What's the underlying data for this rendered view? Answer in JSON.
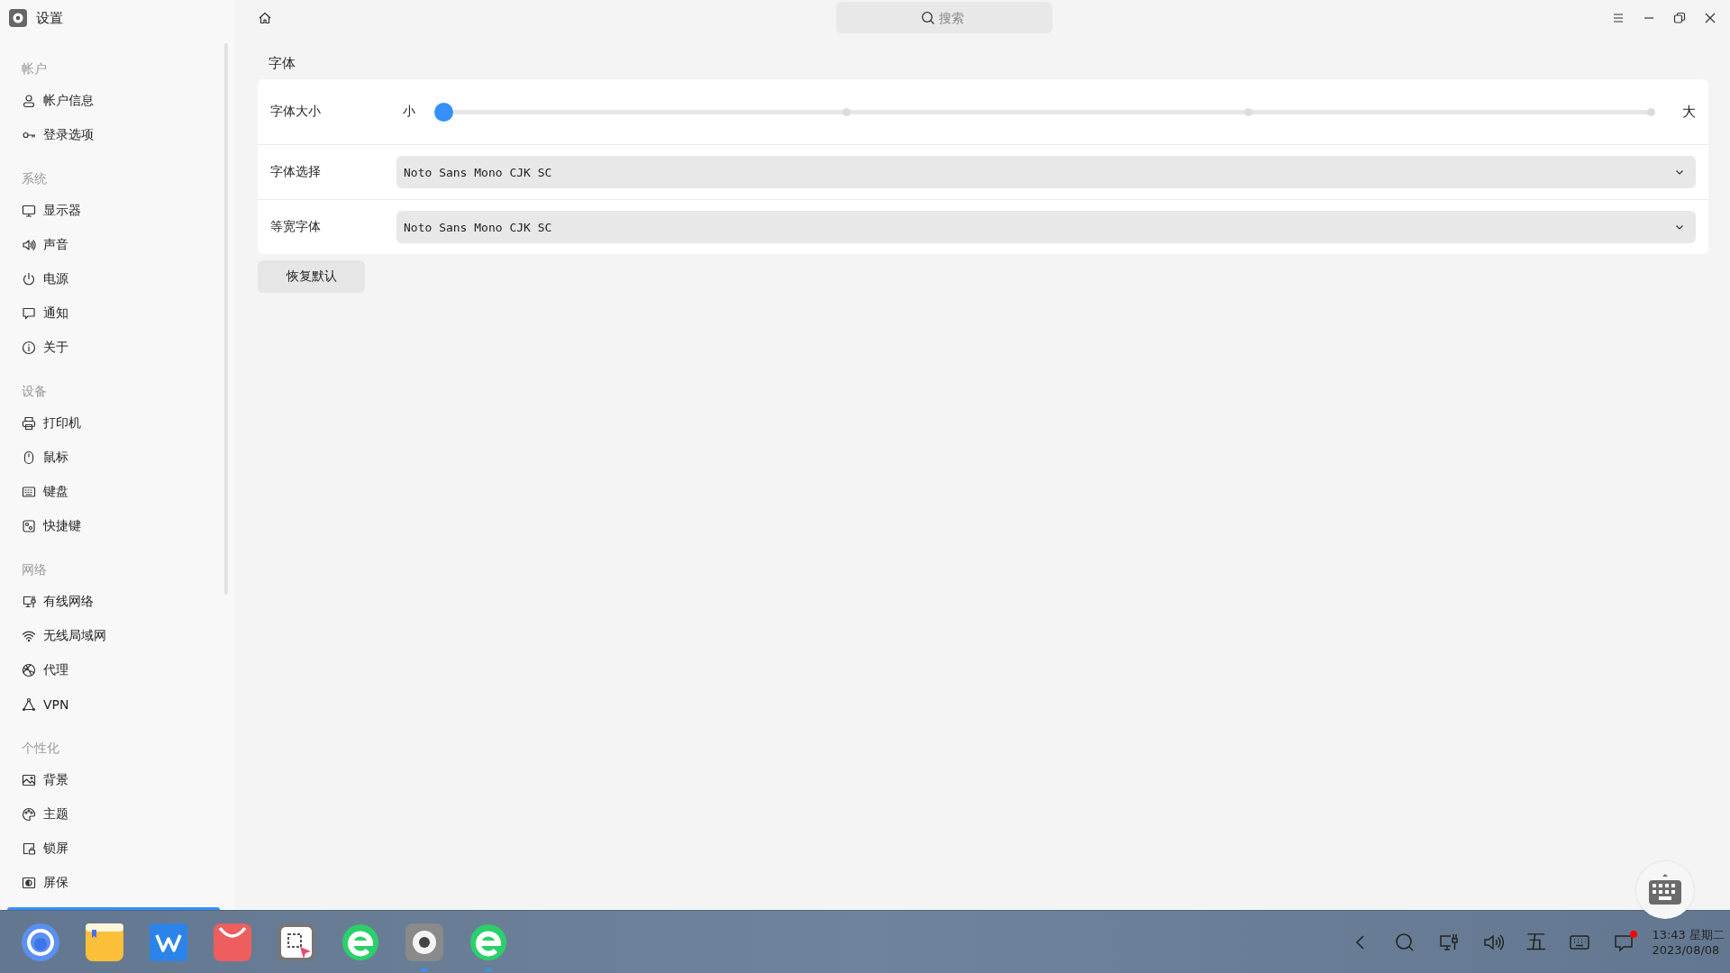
{
  "window": {
    "title": "设置",
    "search_placeholder": "搜索"
  },
  "sidebar": {
    "groups": [
      {
        "heading": "帐户",
        "items": [
          {
            "label": "帐户信息",
            "selected": false
          },
          {
            "label": "登录选项",
            "selected": false
          }
        ]
      },
      {
        "heading": "系统",
        "items": [
          {
            "label": "显示器",
            "selected": false
          },
          {
            "label": "声音",
            "selected": false
          },
          {
            "label": "电源",
            "selected": false
          },
          {
            "label": "通知",
            "selected": false
          },
          {
            "label": "关于",
            "selected": false
          }
        ]
      },
      {
        "heading": "设备",
        "items": [
          {
            "label": "打印机",
            "selected": false
          },
          {
            "label": "鼠标",
            "selected": false
          },
          {
            "label": "键盘",
            "selected": false
          },
          {
            "label": "快捷键",
            "selected": false
          }
        ]
      },
      {
        "heading": "网络",
        "items": [
          {
            "label": "有线网络",
            "selected": false
          },
          {
            "label": "无线局域网",
            "selected": false
          },
          {
            "label": "代理",
            "selected": false
          },
          {
            "label": "VPN",
            "selected": false
          }
        ]
      },
      {
        "heading": "个性化",
        "items": [
          {
            "label": "背景",
            "selected": false
          },
          {
            "label": "主题",
            "selected": false
          },
          {
            "label": "锁屏",
            "selected": false
          },
          {
            "label": "屏保",
            "selected": false
          }
        ]
      }
    ]
  },
  "section": {
    "title": "字体"
  },
  "font_size": {
    "label": "字体大小",
    "min_label": "小",
    "max_label": "大",
    "level": 0
  },
  "selects": [
    {
      "label": "字体选择",
      "value": "Noto Sans Mono CJK SC"
    },
    {
      "label": "等宽字体",
      "value": "Noto Sans Mono CJK SC"
    }
  ],
  "reset_button": "恢复默认",
  "taskbar": {
    "apps": [
      {
        "running": false
      },
      {
        "running": false
      },
      {
        "running": false
      },
      {
        "running": false
      },
      {
        "running": false
      },
      {
        "running": false
      },
      {
        "running": true
      },
      {
        "running": true
      }
    ]
  },
  "tray": {
    "input_method": "五",
    "notification_unread": true,
    "time": "13:43 星期二",
    "date": "2023/08/08"
  }
}
